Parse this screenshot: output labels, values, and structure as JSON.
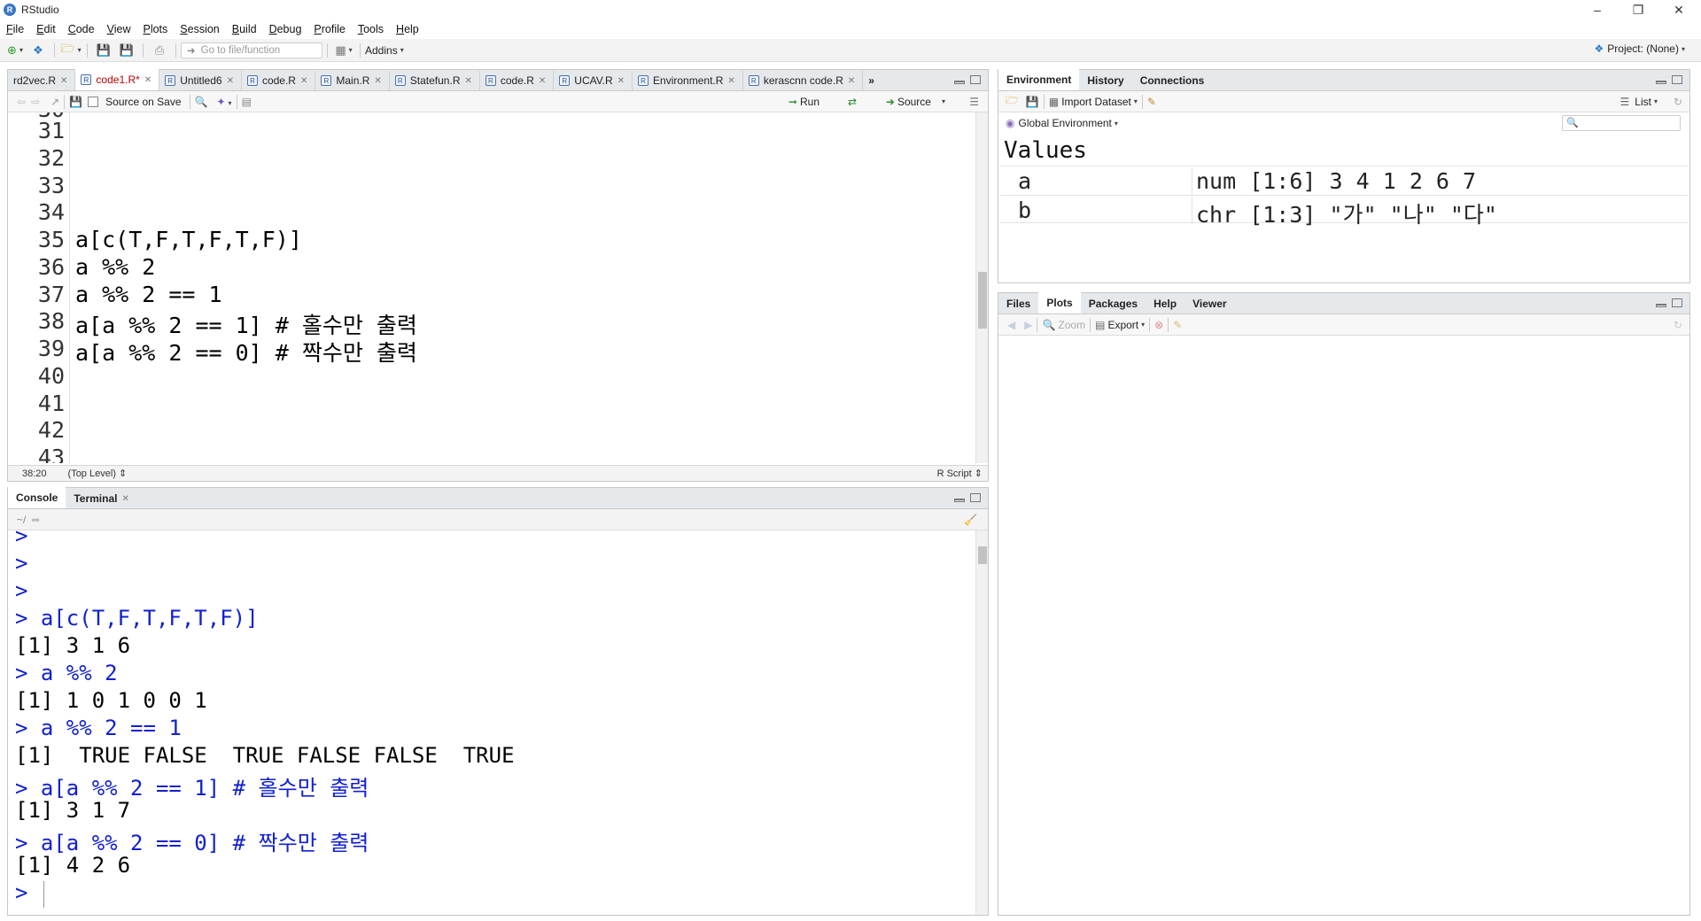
{
  "window": {
    "title": "RStudio",
    "app_icon": "R"
  },
  "menu": [
    "File",
    "Edit",
    "Code",
    "View",
    "Plots",
    "Session",
    "Build",
    "Debug",
    "Profile",
    "Tools",
    "Help"
  ],
  "toolbar": {
    "goto_placeholder": "Go to file/function",
    "addins_label": "Addins",
    "project_label": "Project: (None)"
  },
  "editor": {
    "tabs": [
      {
        "label": "rd2vec.R"
      },
      {
        "label": "code1.R*",
        "active": true
      },
      {
        "label": "Untitled6"
      },
      {
        "label": "code.R"
      },
      {
        "label": "Main.R"
      },
      {
        "label": "Statefun.R"
      },
      {
        "label": "code.R"
      },
      {
        "label": "UCAV.R"
      },
      {
        "label": "Environment.R"
      },
      {
        "label": "kerascnn code.R"
      }
    ],
    "source_on_save": "Source on Save",
    "run_label": "Run",
    "source_label": "Source",
    "line_numbers": [
      "31",
      "32",
      "33",
      "34",
      "35",
      "36",
      "37",
      "38",
      "39",
      "40",
      "41",
      "42",
      "43"
    ],
    "lines": {
      "l35": "a[c(T,F,T,F,T,F)]",
      "l36": "a %% 2",
      "l37": "a %% 2 == 1",
      "l38": "a[a %% 2 == 1] # 홀수만 출력",
      "l39": "a[a %% 2 == 0] # 짝수만 출력"
    },
    "status": {
      "position": "38:20",
      "scope": "(Top Level)",
      "file_type": "R Script"
    }
  },
  "console": {
    "tabs": [
      "Console",
      "Terminal"
    ],
    "working_dir": "~/",
    "lines": [
      {
        "text": ">",
        "kind": "in"
      },
      {
        "text": ">",
        "kind": "in"
      },
      {
        "text": ">",
        "kind": "in"
      },
      {
        "text": "> a[c(T,F,T,F,T,F)]",
        "kind": "in"
      },
      {
        "text": "[1] 3 1 6",
        "kind": "out"
      },
      {
        "text": "> a %% 2",
        "kind": "in"
      },
      {
        "text": "[1] 1 0 1 0 0 1",
        "kind": "out"
      },
      {
        "text": "> a %% 2 == 1",
        "kind": "in"
      },
      {
        "text": "[1]  TRUE FALSE  TRUE FALSE FALSE  TRUE",
        "kind": "out"
      },
      {
        "text": "> a[a %% 2 == 1] # 홀수만 출력",
        "kind": "in"
      },
      {
        "text": "[1] 3 1 7",
        "kind": "out"
      },
      {
        "text": "> a[a %% 2 == 0] # 짝수만 출력",
        "kind": "in"
      },
      {
        "text": "[1] 4 2 6",
        "kind": "out"
      },
      {
        "text": ">",
        "kind": "in"
      }
    ]
  },
  "environment": {
    "tabs": [
      "Environment",
      "History",
      "Connections"
    ],
    "import_dataset": "Import Dataset",
    "list_label": "List",
    "scope": "Global Environment",
    "section": "Values",
    "rows": [
      {
        "name": "a",
        "value": "num [1:6] 3 4 1 2 6 7"
      },
      {
        "name": "b",
        "value": "chr [1:3] \"가\" \"나\" \"다\""
      }
    ]
  },
  "files_pane": {
    "tabs": [
      "Files",
      "Plots",
      "Packages",
      "Help",
      "Viewer"
    ],
    "zoom_label": "Zoom",
    "export_label": "Export"
  }
}
